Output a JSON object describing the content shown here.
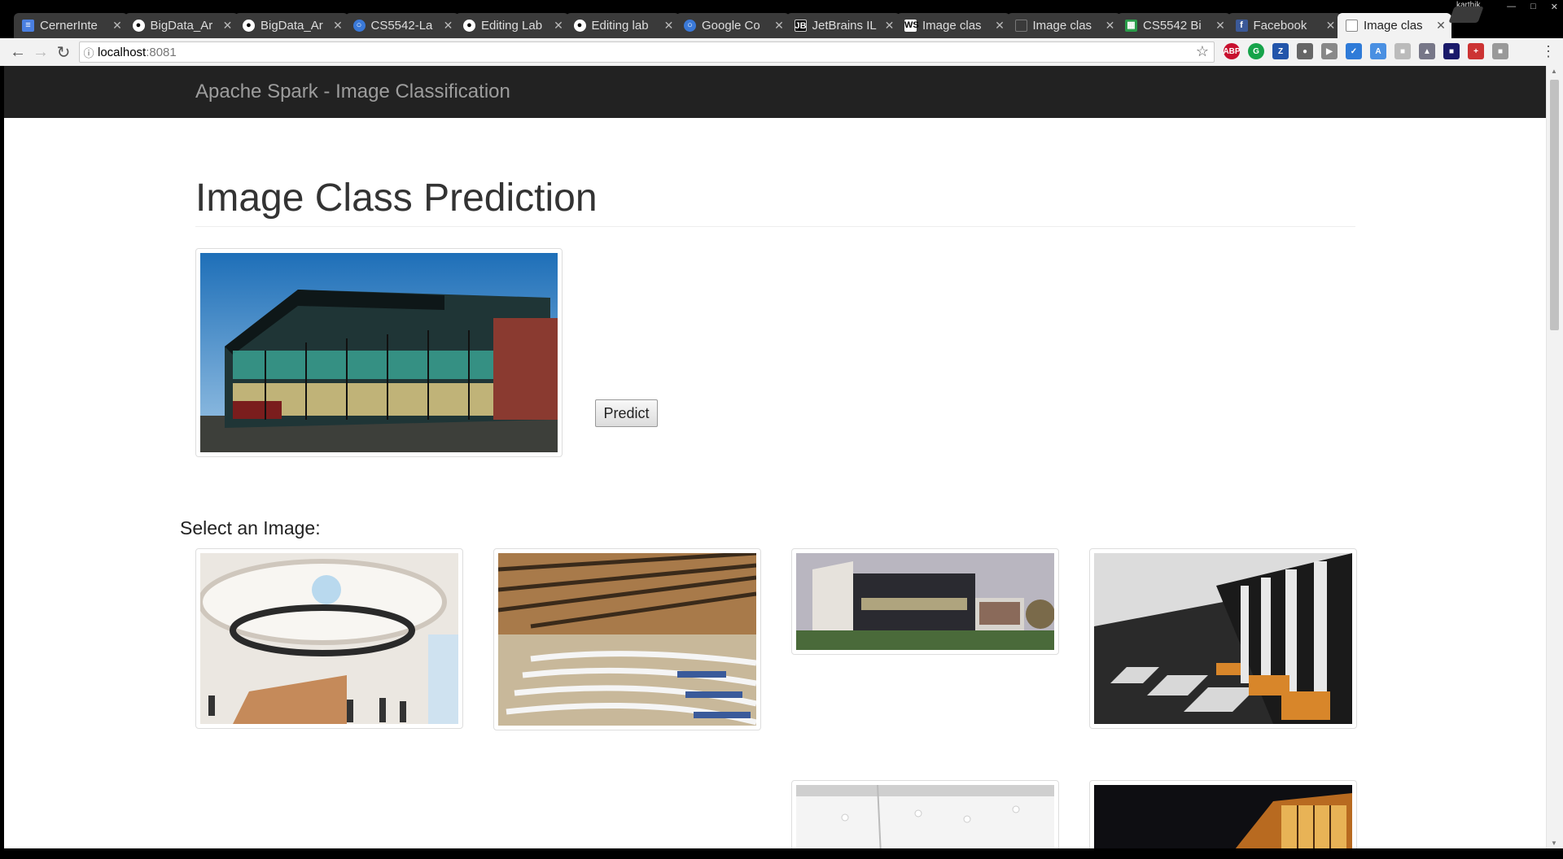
{
  "browser": {
    "tabs": [
      {
        "title": "CernerInte",
        "favicon": "docs-icon",
        "active": false
      },
      {
        "title": "BigData_Ar",
        "favicon": "github-icon",
        "active": false
      },
      {
        "title": "BigData_Ar",
        "favicon": "github-icon",
        "active": false
      },
      {
        "title": "CS5542-La",
        "favicon": "globe-icon",
        "active": false
      },
      {
        "title": "Editing Lab",
        "favicon": "github-icon",
        "active": false
      },
      {
        "title": "Editing lab",
        "favicon": "github-icon",
        "active": false
      },
      {
        "title": "Google Co",
        "favicon": "globe-icon",
        "active": false
      },
      {
        "title": "JetBrains IL",
        "favicon": "jetbrains-icon",
        "active": false
      },
      {
        "title": "Image clas",
        "favicon": "webstorm-icon",
        "active": false
      },
      {
        "title": "Image clas",
        "favicon": "blank-icon",
        "active": false
      },
      {
        "title": "CS5542 Bi",
        "favicon": "sheets-icon",
        "active": false
      },
      {
        "title": "Facebook",
        "favicon": "facebook-icon",
        "active": false
      },
      {
        "title": "Image clas",
        "favicon": "page-icon",
        "active": true
      }
    ],
    "profile": "karthik",
    "url_host": "localhost",
    "url_port": ":8081"
  },
  "navbar": {
    "brand": "Apache Spark - Image Classification"
  },
  "main": {
    "title": "Image Class Prediction",
    "predict_label": "Predict",
    "select_label": "Select an Image:"
  },
  "gallery": [
    {
      "name": "atrium",
      "colors": {
        "bg": "#e8e4de",
        "accent": "#c58a5a"
      }
    },
    {
      "name": "lecture-hall",
      "colors": {
        "bg": "#a87a4a",
        "accent": "#3a5a9a"
      }
    },
    {
      "name": "modern-building",
      "colors": {
        "bg": "#b8b4bc",
        "accent": "#2a2a30"
      }
    },
    {
      "name": "corridor",
      "colors": {
        "bg": "#2a2a2a",
        "accent": "#d8862a"
      }
    },
    {
      "name": "white-room",
      "colors": {
        "bg": "#f2f2f2",
        "accent": "#cfcfcf"
      }
    },
    {
      "name": "night-building",
      "colors": {
        "bg": "#0e0e12",
        "accent": "#e6a040"
      }
    }
  ]
}
